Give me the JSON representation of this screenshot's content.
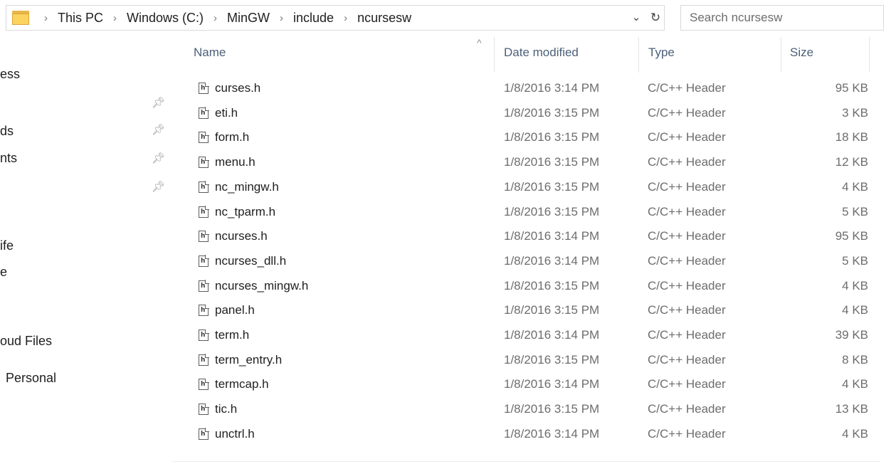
{
  "address": {
    "crumbs": [
      "This PC",
      "Windows (C:)",
      "MinGW",
      "include",
      "ncursesw"
    ],
    "separator": "›",
    "dropdown_glyph": "⌄",
    "refresh_glyph": "↻"
  },
  "search": {
    "placeholder": "Search ncursesw"
  },
  "nav": {
    "items": [
      {
        "label": "ess",
        "pinned": false
      },
      {
        "label": "",
        "pinned": true
      },
      {
        "label": "ds",
        "pinned": true
      },
      {
        "label": "nts",
        "pinned": true
      },
      {
        "label": "",
        "pinned": true
      },
      {
        "label": "ife",
        "pinned": false
      },
      {
        "label": "e",
        "pinned": false
      },
      {
        "label": "oud Files",
        "pinned": false
      },
      {
        "label": "Personal",
        "pinned": false
      }
    ],
    "pin_icon": "pin-icon"
  },
  "columns": {
    "name": "Name",
    "date": "Date modified",
    "type": "Type",
    "size": "Size",
    "sort_glyph": "^"
  },
  "files": [
    {
      "name": "curses.h",
      "date": "1/8/2016 3:14 PM",
      "type": "C/C++ Header",
      "size": "95 KB"
    },
    {
      "name": "eti.h",
      "date": "1/8/2016 3:15 PM",
      "type": "C/C++ Header",
      "size": "3 KB"
    },
    {
      "name": "form.h",
      "date": "1/8/2016 3:15 PM",
      "type": "C/C++ Header",
      "size": "18 KB"
    },
    {
      "name": "menu.h",
      "date": "1/8/2016 3:15 PM",
      "type": "C/C++ Header",
      "size": "12 KB"
    },
    {
      "name": "nc_mingw.h",
      "date": "1/8/2016 3:15 PM",
      "type": "C/C++ Header",
      "size": "4 KB"
    },
    {
      "name": "nc_tparm.h",
      "date": "1/8/2016 3:15 PM",
      "type": "C/C++ Header",
      "size": "5 KB"
    },
    {
      "name": "ncurses.h",
      "date": "1/8/2016 3:14 PM",
      "type": "C/C++ Header",
      "size": "95 KB"
    },
    {
      "name": "ncurses_dll.h",
      "date": "1/8/2016 3:14 PM",
      "type": "C/C++ Header",
      "size": "5 KB"
    },
    {
      "name": "ncurses_mingw.h",
      "date": "1/8/2016 3:15 PM",
      "type": "C/C++ Header",
      "size": "4 KB"
    },
    {
      "name": "panel.h",
      "date": "1/8/2016 3:15 PM",
      "type": "C/C++ Header",
      "size": "4 KB"
    },
    {
      "name": "term.h",
      "date": "1/8/2016 3:14 PM",
      "type": "C/C++ Header",
      "size": "39 KB"
    },
    {
      "name": "term_entry.h",
      "date": "1/8/2016 3:15 PM",
      "type": "C/C++ Header",
      "size": "8 KB"
    },
    {
      "name": "termcap.h",
      "date": "1/8/2016 3:14 PM",
      "type": "C/C++ Header",
      "size": "4 KB"
    },
    {
      "name": "tic.h",
      "date": "1/8/2016 3:15 PM",
      "type": "C/C++ Header",
      "size": "13 KB"
    },
    {
      "name": "unctrl.h",
      "date": "1/8/2016 3:14 PM",
      "type": "C/C++ Header",
      "size": "4 KB"
    }
  ],
  "file_icon": "header-file-icon",
  "file_icon_glyph": "h",
  "colors": {
    "header_text": "#4c607a",
    "secondary_text": "#6d6d6d",
    "folder": "#fbd35e"
  }
}
